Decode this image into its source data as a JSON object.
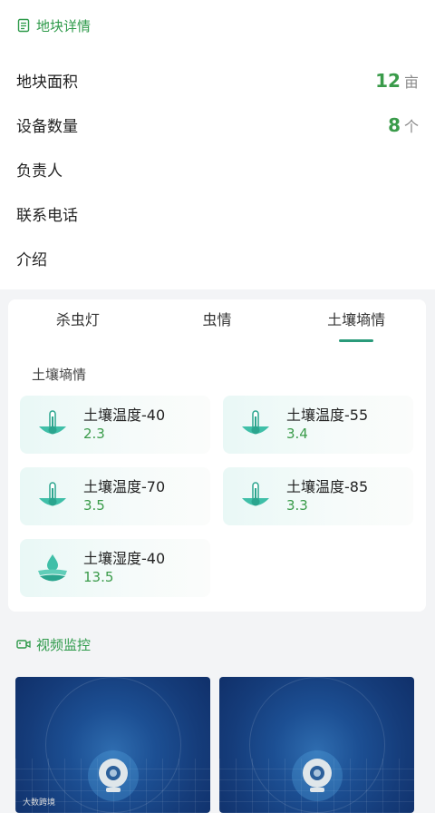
{
  "plot_section": {
    "title": "地块详情",
    "rows": [
      {
        "label": "地块面积",
        "value": "12",
        "unit": "亩"
      },
      {
        "label": "设备数量",
        "value": "8",
        "unit": "个"
      },
      {
        "label": "负责人",
        "value": "",
        "unit": ""
      },
      {
        "label": "联系电话",
        "value": "",
        "unit": ""
      },
      {
        "label": "介绍",
        "value": "",
        "unit": ""
      }
    ]
  },
  "tabs": [
    "杀虫灯",
    "虫情",
    "土壤墒情"
  ],
  "active_tab": "土壤墒情",
  "soil_section": {
    "title": "土壤墒情",
    "sensors": [
      {
        "name": "土壤温度-40",
        "value": "2.3",
        "icon": "soil-thermometer-icon"
      },
      {
        "name": "土壤温度-55",
        "value": "3.4",
        "icon": "soil-thermometer-icon"
      },
      {
        "name": "土壤温度-70",
        "value": "3.5",
        "icon": "soil-thermometer-icon"
      },
      {
        "name": "土壤温度-85",
        "value": "3.3",
        "icon": "soil-thermometer-icon"
      },
      {
        "name": "土壤湿度-40",
        "value": "13.5",
        "icon": "soil-moisture-icon"
      }
    ]
  },
  "video_section": {
    "title": "视频监控",
    "watermark": "大数跨境"
  },
  "colors": {
    "accent_green": "#3a9b4a",
    "tab_underline": "#2a9b7a",
    "video_bg": "#1c4f93"
  }
}
